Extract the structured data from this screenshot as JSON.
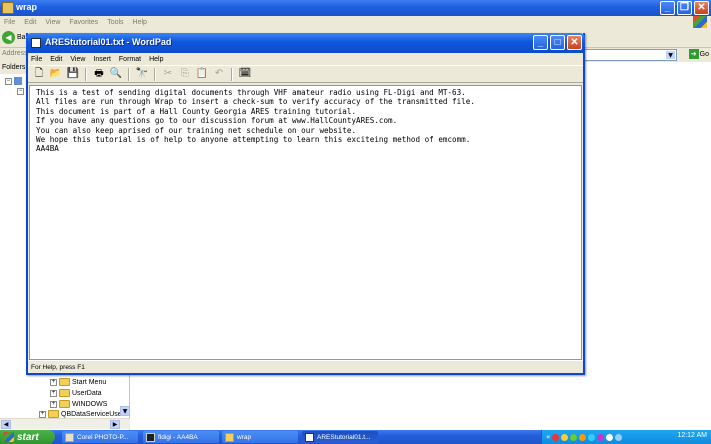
{
  "explorer": {
    "title": "wrap",
    "menu": [
      "File",
      "Edit",
      "View",
      "Favorites",
      "Tools",
      "Help"
    ],
    "back_label": "Ba",
    "address_label": "Address",
    "go_label": "Go",
    "folders_label": "Folders",
    "tree": [
      "Start Menu",
      "UserData",
      "WINDOWS",
      "QBDataServiceUser"
    ]
  },
  "wordpad": {
    "title": "AREStutorial01.txt - WordPad",
    "menu": [
      "File",
      "Edit",
      "View",
      "Insert",
      "Format",
      "Help"
    ],
    "toolbar": [
      {
        "name": "new-document-icon",
        "glyph": "🗋"
      },
      {
        "name": "open-folder-icon",
        "glyph": "📂"
      },
      {
        "name": "save-icon",
        "glyph": "💾"
      },
      {
        "name": "print-icon",
        "glyph": "🖶"
      },
      {
        "name": "print-preview-icon",
        "glyph": "🔍"
      },
      {
        "name": "find-icon",
        "glyph": "🔭"
      },
      {
        "name": "cut-icon",
        "glyph": "✂"
      },
      {
        "name": "copy-icon",
        "glyph": "⎘"
      },
      {
        "name": "paste-icon",
        "glyph": "📋"
      },
      {
        "name": "undo-icon",
        "glyph": "↶"
      },
      {
        "name": "date-time-icon",
        "glyph": "🗓"
      }
    ],
    "document_lines": [
      "This is a test of sending digital documents through VHF amateur radio using FL-Digi and MT-63.",
      "All files are run through Wrap to insert a check-sum to verify accuracy of the transmitted file.",
      "This document is part of a Hall County Georgia ARES training tutorial.",
      "If you have any questions go to our discussion forum at www.HallCountyARES.com.",
      "You can also keep aprised of our training net schedule on our website.",
      "We hope this tutorial is of help to anyone attempting to learn this exciteing method of emcomm.",
      "AA4BA"
    ],
    "status": "For Help, press F1"
  },
  "taskbar": {
    "start_label": "start",
    "tasks": [
      "Corel PHOTO-P...",
      "fldigi - AA4BA",
      "wrap",
      "AREStutorial01.t..."
    ],
    "clock": "12:12 AM"
  },
  "colors": {
    "xp_blue": "#0a48d4",
    "start_green": "#309530",
    "tray_blue": "#0f8be0"
  }
}
